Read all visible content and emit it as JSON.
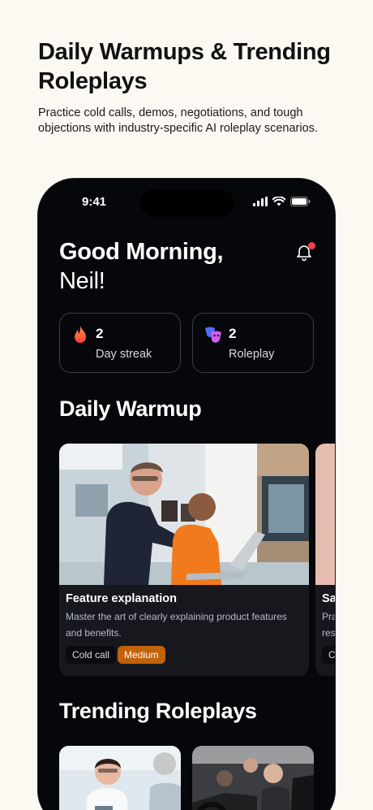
{
  "page": {
    "headline": "Daily Warmups & Trending Roleplays",
    "subheadline": "Practice cold calls, demos, negotiations, and tough objections with industry-specific AI roleplay scenarios."
  },
  "status_bar": {
    "time": "9:41",
    "icons": [
      "signal-icon",
      "wifi-icon",
      "battery-icon"
    ]
  },
  "greeting": {
    "line1": "Good Morning,",
    "line2": "Neil!",
    "notification_icon": "bell-icon",
    "has_unread": true
  },
  "stats": [
    {
      "icon": "flame-icon",
      "value": "2",
      "label": "Day streak"
    },
    {
      "icon": "masks-icon",
      "value": "2",
      "label": "Roleplay"
    }
  ],
  "daily_warmup": {
    "title": "Daily Warmup",
    "cards": [
      {
        "title": "Feature explanation",
        "description": "Master the art of clearly explaining product features and benefits.",
        "tags": [
          "Cold call",
          "Medium"
        ]
      },
      {
        "title": "Sa",
        "description_lines": [
          "Pra",
          "res"
        ],
        "tag": "C"
      }
    ]
  },
  "trending_roleplays": {
    "title": "Trending Roleplays"
  },
  "colors": {
    "page_bg": "#fcf8f2",
    "phone_bg": "#05070b",
    "card_bg": "#16181d",
    "accent_orange": "#c2620b",
    "notification_red": "#ef4444"
  }
}
